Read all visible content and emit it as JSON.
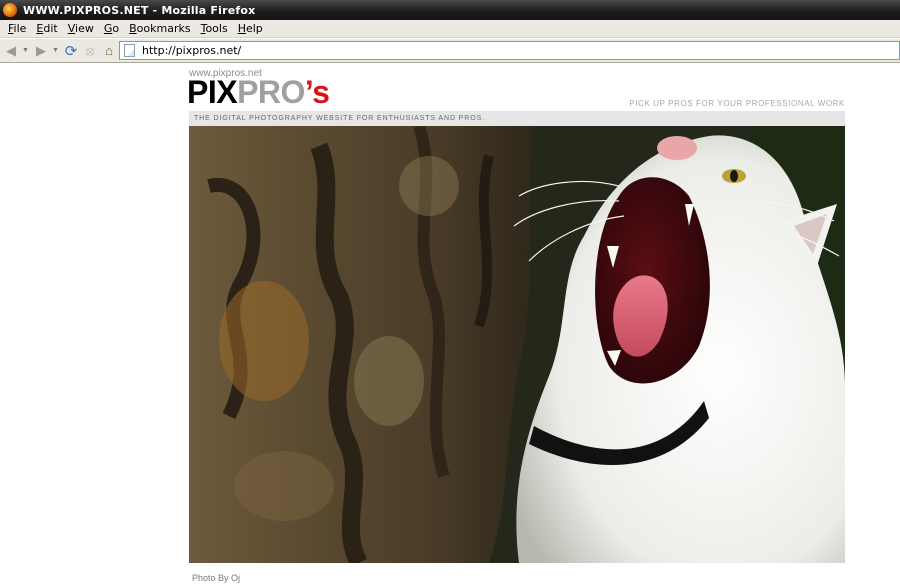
{
  "window": {
    "title": "WWW.PIXPROS.NET - Mozilla Firefox"
  },
  "menubar": {
    "items": [
      {
        "first": "F",
        "rest": "ile"
      },
      {
        "first": "E",
        "rest": "dit"
      },
      {
        "first": "V",
        "rest": "iew"
      },
      {
        "first": "G",
        "rest": "o"
      },
      {
        "first": "B",
        "rest": "ookmarks"
      },
      {
        "first": "T",
        "rest": "ools"
      },
      {
        "first": "H",
        "rest": "elp"
      }
    ]
  },
  "navbar": {
    "url": "http://pixpros.net/",
    "icons": {
      "back": "back-arrow-icon",
      "forward": "forward-arrow-icon",
      "reload": "reload-icon",
      "stop": "stop-icon",
      "home": "home-icon"
    }
  },
  "page": {
    "site_url": "www.pixpros.net",
    "logo": {
      "pix": "PIX",
      "pro": "PRO",
      "s": "’s"
    },
    "tagline": "PICK UP PROS FOR YOUR PROFESSIONAL WORK",
    "subtitle": "THE DIGITAL PHOTOGRAPHY WEBSITE FOR ENTHUSIASTS AND PROS.",
    "photo_credit": "Photo By  Oj"
  },
  "colors": {
    "logo_pix": "#000000",
    "logo_pro": "#a0a0a0",
    "logo_s": "#d8121b"
  }
}
